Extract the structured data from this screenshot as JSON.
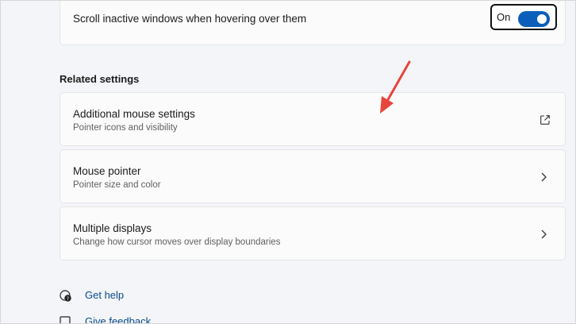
{
  "scroll_setting": {
    "label": "Scroll inactive windows when hovering over them",
    "toggle_state": "On",
    "toggle_on": true
  },
  "related_settings": {
    "heading": "Related settings",
    "items": [
      {
        "title": "Additional mouse settings",
        "subtitle": "Pointer icons and visibility",
        "icon": "external-link-icon"
      },
      {
        "title": "Mouse pointer",
        "subtitle": "Pointer size and color",
        "icon": "chevron-right-icon"
      },
      {
        "title": "Multiple displays",
        "subtitle": "Change how cursor moves over display boundaries",
        "icon": "chevron-right-icon"
      }
    ]
  },
  "help": {
    "get_help": "Get help",
    "give_feedback": "Give feedback"
  },
  "colors": {
    "accent": "#0b5fba",
    "annotation_arrow": "#e8453c",
    "link": "#0b4a8a"
  }
}
